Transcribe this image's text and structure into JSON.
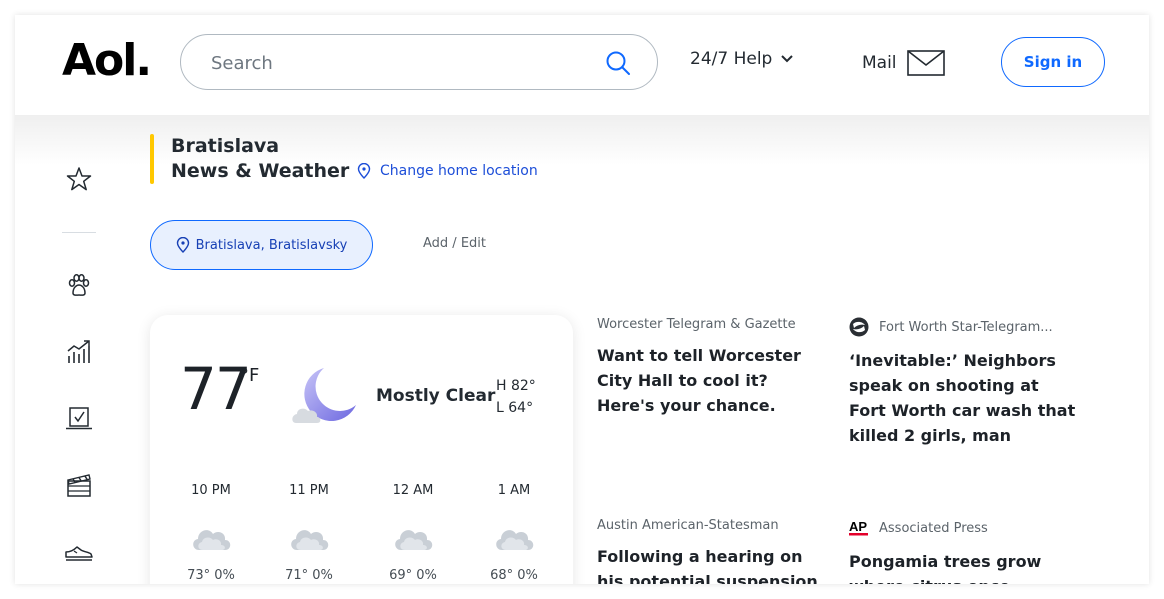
{
  "header": {
    "logo": "Aol.",
    "search_placeholder": "Search",
    "help_label": "24/7 Help",
    "mail_label": "Mail",
    "signin_label": "Sign in"
  },
  "location": {
    "title_line1": "Bratislava",
    "title_line2": "News & Weather",
    "change_label": "Change home location",
    "chip_label": "Bratislava, Bratislavsky",
    "add_edit_label": "Add / Edit"
  },
  "weather": {
    "temp": "77",
    "unit": "°F",
    "condition": "Mostly Clear",
    "high": "H  82°",
    "low": "L  64°",
    "hourly": [
      {
        "time": "10 PM",
        "stats": "73°  0%"
      },
      {
        "time": "11 PM",
        "stats": "71°  0%"
      },
      {
        "time": "12 AM",
        "stats": "69°  0%"
      },
      {
        "time": "1 AM",
        "stats": "68°  0%"
      }
    ]
  },
  "news": [
    {
      "source": "Worcester Telegram & Gazette",
      "headline": "Want to tell Worcester City Hall to cool it? Here's your chance.",
      "icon": "none"
    },
    {
      "source": "Fort Worth Star-Telegram...",
      "headline": "‘Inevitable:’ Neighbors speak on shooting at Fort Worth car wash that killed 2 girls, man",
      "icon": "star-telegram-icon"
    },
    {
      "source": "Austin American-Statesman",
      "headline": "Following a hearing on his potential suspension, Hays",
      "icon": "none"
    },
    {
      "source": "Associated Press",
      "headline": "Pongamia trees grow where citrus once",
      "icon": "ap-icon"
    }
  ],
  "rail_icons": [
    "star-icon",
    "paw-icon",
    "chart-icon",
    "checkbox-icon",
    "clapperboard-icon",
    "sneaker-icon"
  ],
  "colors": {
    "accent": "#0f69ff",
    "location_bar": "#ffc800",
    "chip_bg": "#e8f0fe"
  }
}
